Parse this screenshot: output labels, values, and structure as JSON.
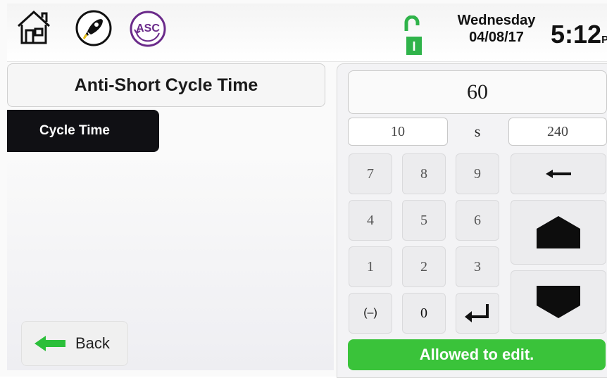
{
  "header": {
    "icons": [
      "home-icon",
      "rocket-icon",
      "asc-icon"
    ],
    "asc_label": "ASC",
    "lock_mode": "I",
    "day": "Wednesday",
    "date": "04/08/17",
    "time": "5:12",
    "ampm": "PM"
  },
  "left": {
    "title": "Anti-Short Cycle Time",
    "menu_item": "Cycle Time",
    "back_label": "Back"
  },
  "keypad": {
    "value": "60",
    "min": "10",
    "unit": "s",
    "max": "240",
    "keys": [
      "7",
      "8",
      "9",
      "4",
      "5",
      "6",
      "1",
      "2",
      "3",
      "(–)",
      "0"
    ],
    "status": "Allowed to edit."
  },
  "colors": {
    "status_green": "#3ac33a",
    "accent_purple": "#6a2a8a",
    "lock_green": "#2fb34a"
  }
}
